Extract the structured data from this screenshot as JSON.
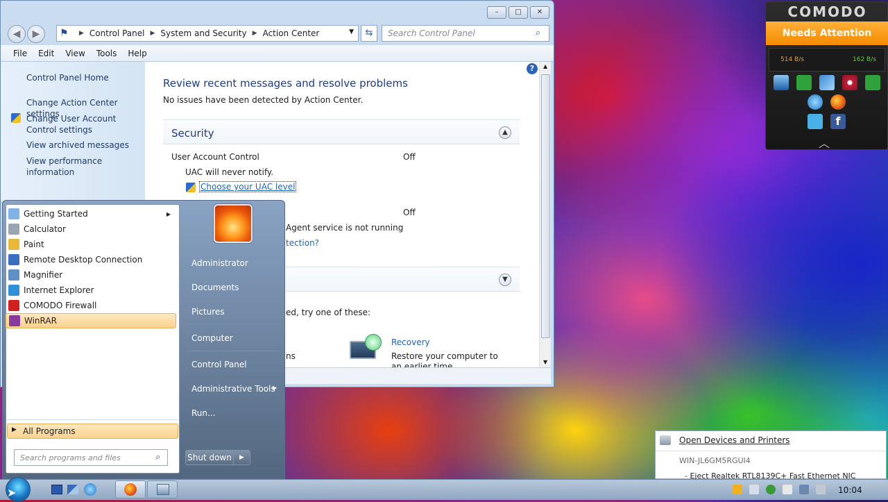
{
  "window": {
    "controls": [
      "–",
      "□",
      "✕"
    ],
    "breadcrumb": [
      "Control Panel",
      "System and Security",
      "Action Center"
    ],
    "search_placeholder": "Search Control Panel",
    "menu": [
      "File",
      "Edit",
      "View",
      "Tools",
      "Help"
    ],
    "left_links": [
      "Control Panel Home",
      "Change Action Center settings",
      "Change User Account Control settings",
      "View archived messages",
      "View performance information"
    ],
    "heading": "Review recent messages and resolve problems",
    "subheading": "No issues have been detected by Action Center.",
    "security_title": "Security",
    "uac_label": "User Account Control",
    "uac_state": "Off",
    "uac_note": "UAC will never notify.",
    "uac_link": "Choose your UAC level",
    "row2_state": "Off",
    "row2_text": "Agent service is not running",
    "row2_link": "tection?",
    "try_text": "ed, try one of these:",
    "recovery_link": "Recovery",
    "recovery_desc_1": "Restore your computer to",
    "recovery_desc_2": "an earlier time",
    "left_fragment": "ns"
  },
  "start_menu": {
    "programs": [
      {
        "label": "Getting Started",
        "icon": "getting-started-icon",
        "color": "#7fb3e6",
        "arrow": true
      },
      {
        "label": "Calculator",
        "icon": "calculator-icon",
        "color": "#9aa5b2"
      },
      {
        "label": "Paint",
        "icon": "paint-icon",
        "color": "#e8b83a"
      },
      {
        "label": "Remote Desktop Connection",
        "icon": "remote-desktop-icon",
        "color": "#3a6fbf"
      },
      {
        "label": "Magnifier",
        "icon": "magnifier-icon",
        "color": "#5f8fc7"
      },
      {
        "label": "Internet Explorer",
        "icon": "internet-explorer-icon",
        "color": "#2f8fd8"
      },
      {
        "label": "COMODO Firewall",
        "icon": "comodo-firewall-icon",
        "color": "#d02020"
      },
      {
        "label": "WinRAR",
        "icon": "winrar-icon",
        "color": "#8a3a9c",
        "highlight": true
      }
    ],
    "all_programs": "All Programs",
    "search_placeholder": "Search programs and files",
    "right_items": [
      "Administrator",
      "Documents",
      "Pictures",
      "Computer",
      "Control Panel",
      "Administrative Tools",
      "Run..."
    ],
    "shutdown": "Shut down"
  },
  "comodo": {
    "brand": "COMODO",
    "status": "Needs Attention",
    "speed_down": "514 B/s",
    "speed_up": "162 B/s"
  },
  "notification": {
    "title": "Open Devices and Printers",
    "computer": "WIN-JL6GM5RGUI4",
    "item": "Eject Realtek RTL8139C+ Fast Ethernet NIC"
  },
  "taskbar": {
    "clock": "10:04"
  },
  "colors": {
    "accent_orange": "#f58a00",
    "link_blue": "#1e64b4",
    "heading_blue": "#1e3b84"
  }
}
